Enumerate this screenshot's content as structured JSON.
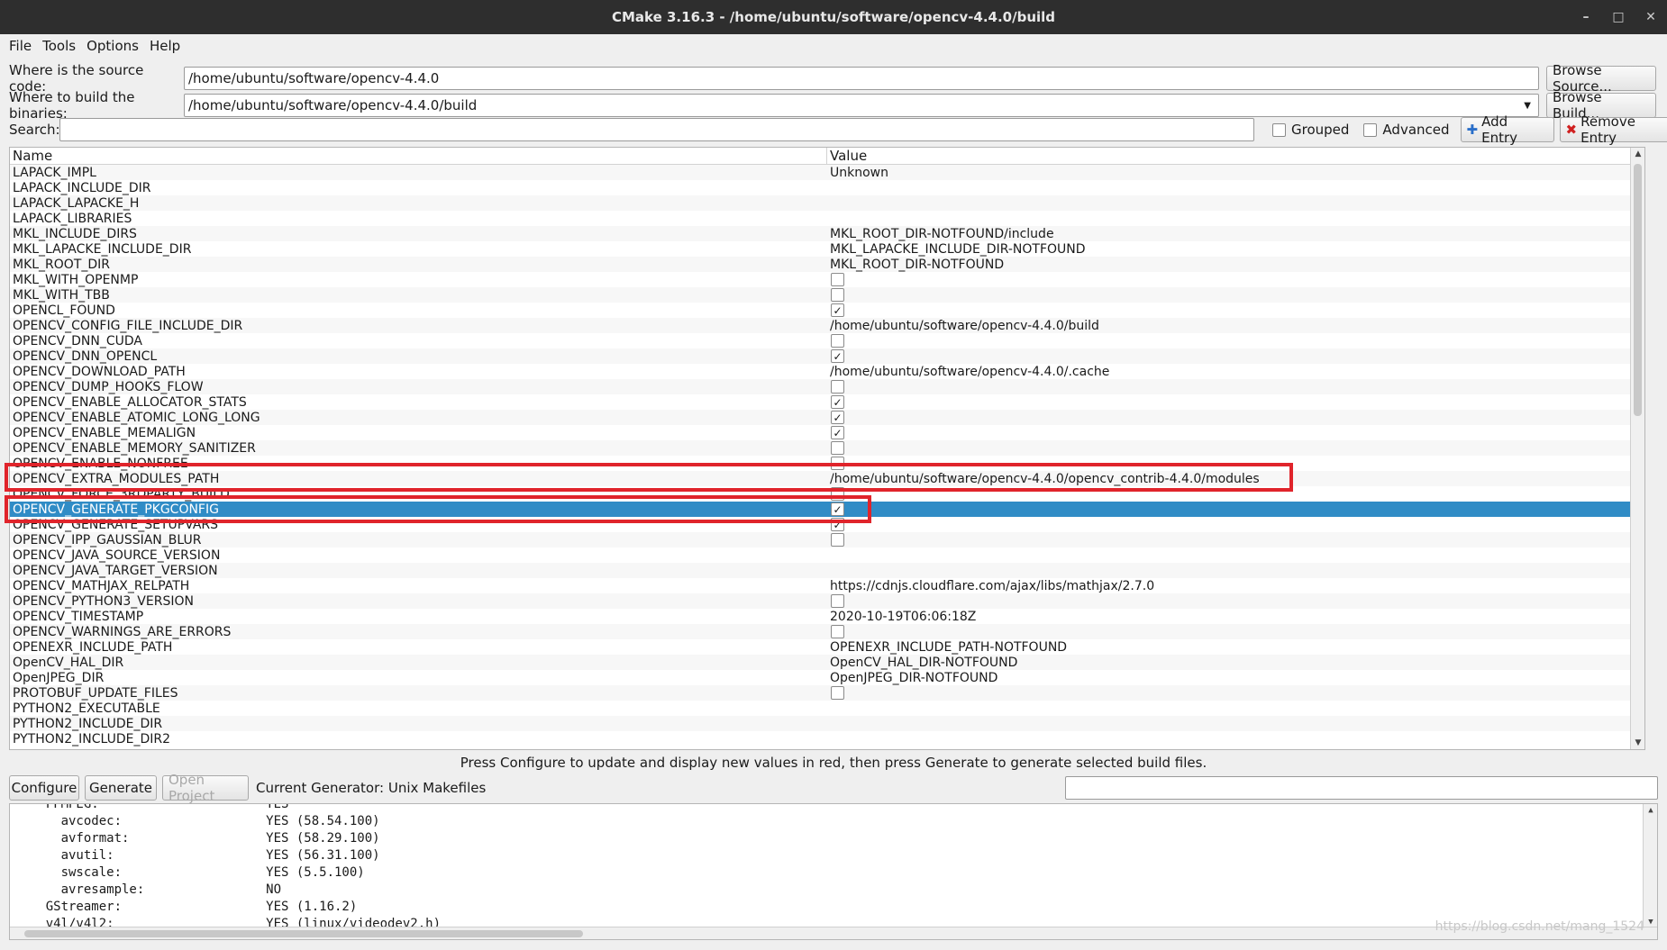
{
  "window": {
    "title": "CMake 3.16.3 - /home/ubuntu/software/opencv-4.4.0/build"
  },
  "menu": [
    "File",
    "Tools",
    "Options",
    "Help"
  ],
  "source": {
    "label": "Where is the source code:",
    "value": "/home/ubuntu/software/opencv-4.4.0",
    "button": "Browse Source..."
  },
  "build": {
    "label": "Where to build the binaries:",
    "value": "/home/ubuntu/software/opencv-4.4.0/build",
    "button": "Browse Build..."
  },
  "search": {
    "label": "Search:",
    "value": "",
    "grouped": "Grouped",
    "advanced": "Advanced",
    "add": "Add Entry",
    "remove": "Remove Entry"
  },
  "table": {
    "headers": {
      "name": "Name",
      "value": "Value"
    },
    "rows": [
      {
        "name": "LAPACK_IMPL",
        "value": "Unknown"
      },
      {
        "name": "LAPACK_INCLUDE_DIR",
        "value": ""
      },
      {
        "name": "LAPACK_LAPACKE_H",
        "value": ""
      },
      {
        "name": "LAPACK_LIBRARIES",
        "value": ""
      },
      {
        "name": "MKL_INCLUDE_DIRS",
        "value": "MKL_ROOT_DIR-NOTFOUND/include"
      },
      {
        "name": "MKL_LAPACKE_INCLUDE_DIR",
        "value": "MKL_LAPACKE_INCLUDE_DIR-NOTFOUND"
      },
      {
        "name": "MKL_ROOT_DIR",
        "value": "MKL_ROOT_DIR-NOTFOUND"
      },
      {
        "name": "MKL_WITH_OPENMP",
        "check": false
      },
      {
        "name": "MKL_WITH_TBB",
        "check": false
      },
      {
        "name": "OPENCL_FOUND",
        "check": true
      },
      {
        "name": "OPENCV_CONFIG_FILE_INCLUDE_DIR",
        "value": "/home/ubuntu/software/opencv-4.4.0/build"
      },
      {
        "name": "OPENCV_DNN_CUDA",
        "check": false
      },
      {
        "name": "OPENCV_DNN_OPENCL",
        "check": true
      },
      {
        "name": "OPENCV_DOWNLOAD_PATH",
        "value": "/home/ubuntu/software/opencv-4.4.0/.cache"
      },
      {
        "name": "OPENCV_DUMP_HOOKS_FLOW",
        "check": false
      },
      {
        "name": "OPENCV_ENABLE_ALLOCATOR_STATS",
        "check": true
      },
      {
        "name": "OPENCV_ENABLE_ATOMIC_LONG_LONG",
        "check": true
      },
      {
        "name": "OPENCV_ENABLE_MEMALIGN",
        "check": true
      },
      {
        "name": "OPENCV_ENABLE_MEMORY_SANITIZER",
        "check": false
      },
      {
        "name": "OPENCV_ENABLE_NONFREE",
        "check": false
      },
      {
        "name": "OPENCV_EXTRA_MODULES_PATH",
        "value": "/home/ubuntu/software/opencv-4.4.0/opencv_contrib-4.4.0/modules"
      },
      {
        "name": "OPENCV_FORCE_3RDPARTY_BUILD",
        "check": false
      },
      {
        "name": "OPENCV_GENERATE_PKGCONFIG",
        "check": true,
        "selected": true
      },
      {
        "name": "OPENCV_GENERATE_SETUPVARS",
        "check": true
      },
      {
        "name": "OPENCV_IPP_GAUSSIAN_BLUR",
        "check": false
      },
      {
        "name": "OPENCV_JAVA_SOURCE_VERSION",
        "value": ""
      },
      {
        "name": "OPENCV_JAVA_TARGET_VERSION",
        "value": ""
      },
      {
        "name": "OPENCV_MATHJAX_RELPATH",
        "value": "https://cdnjs.cloudflare.com/ajax/libs/mathjax/2.7.0"
      },
      {
        "name": "OPENCV_PYTHON3_VERSION",
        "check": false
      },
      {
        "name": "OPENCV_TIMESTAMP",
        "value": "2020-10-19T06:06:18Z"
      },
      {
        "name": "OPENCV_WARNINGS_ARE_ERRORS",
        "check": false
      },
      {
        "name": "OPENEXR_INCLUDE_PATH",
        "value": "OPENEXR_INCLUDE_PATH-NOTFOUND"
      },
      {
        "name": "OpenCV_HAL_DIR",
        "value": "OpenCV_HAL_DIR-NOTFOUND"
      },
      {
        "name": "OpenJPEG_DIR",
        "value": "OpenJPEG_DIR-NOTFOUND"
      },
      {
        "name": "PROTOBUF_UPDATE_FILES",
        "check": false
      },
      {
        "name": "PYTHON2_EXECUTABLE",
        "value": ""
      },
      {
        "name": "PYTHON2_INCLUDE_DIR",
        "value": ""
      },
      {
        "name": "PYTHON2_INCLUDE_DIR2",
        "value": ""
      }
    ]
  },
  "info": "Press Configure to update and display new values in red, then press Generate to generate selected build files.",
  "actions": {
    "configure": "Configure",
    "generate": "Generate",
    "open_project": "Open Project",
    "generator": "Current Generator: Unix Makefiles"
  },
  "log": [
    "    FFMPEG:                      YES",
    "      avcodec:                   YES (58.54.100)",
    "      avformat:                  YES (58.29.100)",
    "      avutil:                    YES (56.31.100)",
    "      swscale:                   YES (5.5.100)",
    "      avresample:                NO",
    "    GStreamer:                   YES (1.16.2)",
    "    v4l/v4l2:                    YES (linux/videodev2.h)"
  ],
  "watermark": "https://blog.csdn.net/mang_1524"
}
